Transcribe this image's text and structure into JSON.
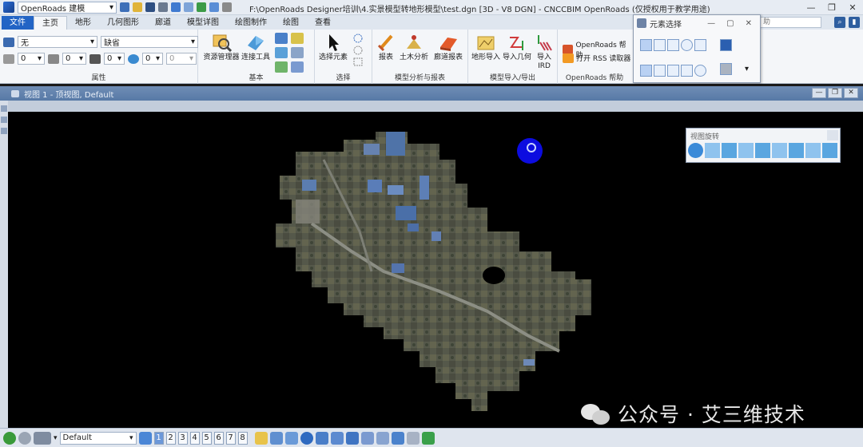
{
  "titlebar": {
    "workspace": "OpenRoads 建模",
    "title": "F:\\OpenRoads Designer培训\\4.实景模型转地形模型\\test.dgn [3D - V8 DGN] - CNCCBIM OpenRoads (仅授权用于教学用途)",
    "minimize": "—",
    "maximize": "❐",
    "close": "✕"
  },
  "tabs": [
    {
      "label": "文件"
    },
    {
      "label": "主页"
    },
    {
      "label": "地形"
    },
    {
      "label": "几何图形"
    },
    {
      "label": "廊道"
    },
    {
      "label": "模型详图"
    },
    {
      "label": "绘图制作"
    },
    {
      "label": "绘图"
    },
    {
      "label": "查看"
    }
  ],
  "search": {
    "placeholder": "助"
  },
  "ribbon": {
    "attributes": {
      "label": "属性",
      "level_value": "无",
      "style_value": "缺省",
      "fields": [
        "0",
        "0",
        "0",
        "0",
        "0"
      ]
    },
    "basic": {
      "label": "基本",
      "resource_manager": "资源管理器",
      "connect_tools": "连接工具"
    },
    "select": {
      "label": "选择",
      "select_element": "选择元素"
    },
    "model_analysis": {
      "label": "模型分析与报表",
      "report": "报表",
      "civil_analysis": "土木分析",
      "corridor_report": "廊道报表"
    },
    "model_io": {
      "label": "模型导入/导出",
      "terrain_import": "地形导入",
      "import_geometry": "导入几何",
      "import_ird": "导入\nIRD"
    },
    "help": {
      "label": "OpenRoads 帮助",
      "openroads_help": "OpenRoads 帮助",
      "rss": "打开 RSS 读取器"
    }
  },
  "element_selection": {
    "title": "元素选择"
  },
  "view": {
    "title": "视图 1 - 顶视图, Default"
  },
  "view_rotation": {
    "title": "视图旋转"
  },
  "watermark": {
    "text": "公众号 · 艾三维技术"
  },
  "bottombar": {
    "model": "Default",
    "views": [
      "1",
      "2",
      "3",
      "4",
      "5",
      "6",
      "7",
      "8"
    ],
    "active_view": "1"
  },
  "colors": {
    "accent": "#2264c5",
    "cursor": "#0c0ce0",
    "canvas": "#000000"
  }
}
